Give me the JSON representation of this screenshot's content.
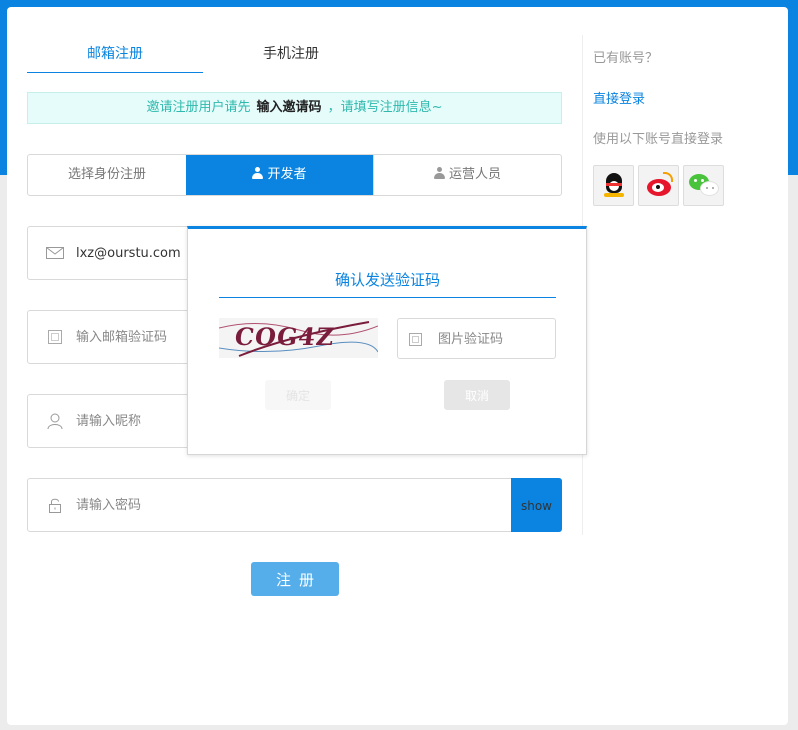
{
  "tabs": {
    "email": "邮箱注册",
    "phone": "手机注册"
  },
  "notice": {
    "prefix": "邀请注册用户请先",
    "highlight": "输入邀请码",
    "suffix": "，请填写注册信息~"
  },
  "identity": {
    "label": "选择身份注册",
    "developer": "开发者",
    "operator": "运营人员"
  },
  "form": {
    "email_value": "lxz@ourstu.com",
    "email_code_placeholder": "输入邮箱验证码",
    "nickname_placeholder": "请输入昵称",
    "password_placeholder": "请输入密码",
    "show_label": "show",
    "register_label": "注册"
  },
  "side": {
    "have_account": "已有账号？",
    "direct_login": "直接登录",
    "third_party": "使用以下账号直接登录"
  },
  "modal": {
    "title": "确认发送验证码",
    "captcha_text": "COG4Z",
    "code_placeholder": "图片验证码",
    "confirm_label": "确定",
    "cancel_label": "取消"
  },
  "colors": {
    "primary": "#0a84e0",
    "register_button": "#55aeea",
    "notice_text": "#2fb9ad"
  }
}
